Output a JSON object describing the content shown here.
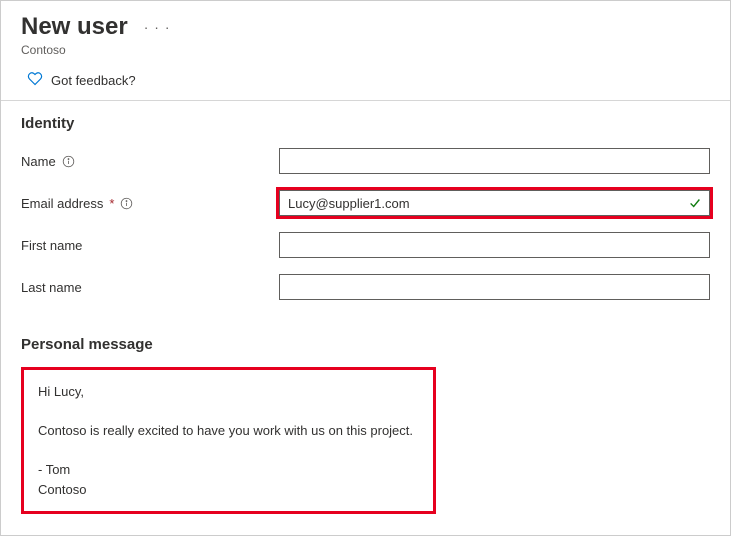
{
  "header": {
    "title": "New user",
    "org": "Contoso"
  },
  "feedback": {
    "text": "Got feedback?"
  },
  "identity": {
    "title": "Identity",
    "fields": {
      "name": {
        "label": "Name",
        "value": ""
      },
      "email": {
        "label": "Email address",
        "value": "Lucy@supplier1.com",
        "valid": true
      },
      "first_name": {
        "label": "First name",
        "value": ""
      },
      "last_name": {
        "label": "Last name",
        "value": ""
      }
    }
  },
  "personal_message": {
    "title": "Personal message",
    "body": "Hi Lucy,\n\nContoso is really excited to have you work with us on this project.\n\n- Tom\nContoso"
  },
  "colors": {
    "highlight": "#e6001f",
    "success": "#107c10",
    "heart": "#0078d4"
  }
}
